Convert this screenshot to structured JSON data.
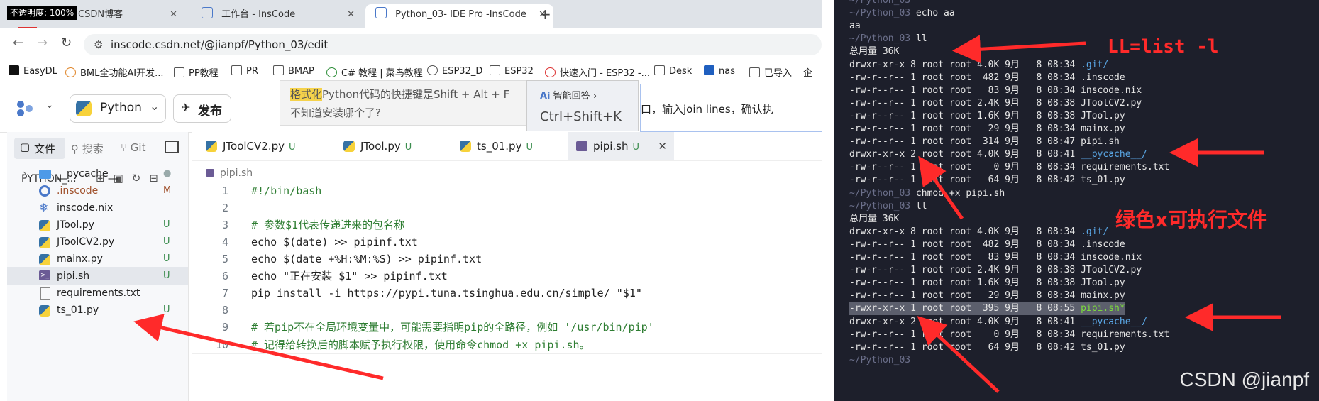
{
  "browser": {
    "opacity_badge": "不透明度: 100%",
    "tabs": [
      {
        "label": "CSDN博客",
        "close": "✕"
      },
      {
        "label": "工作台 - InsCode",
        "close": "✕"
      },
      {
        "label": "Python_03- IDE Pro -InsCode",
        "close": "✕"
      }
    ],
    "new_tab": "+",
    "url": "inscode.csdn.net/@jianpf/Python_03/edit",
    "bookmarks": [
      "EasyDL",
      "BML全功能AI开发...",
      "PP教程",
      "PR",
      "BMAP",
      "C# 教程 | 菜鸟教程",
      "ESP32_D",
      "ESP32",
      "快速入门 - ESP32 -...",
      "Desk",
      "nas",
      "已导入",
      "企"
    ]
  },
  "ide": {
    "lang": "Python",
    "publish": "发布",
    "tooltip": {
      "line1_hl": "格式化",
      "line1_rest": "Python代码的快捷键是Shift + Alt + F",
      "line2": "不知道安装哪个了?",
      "ai_label": "智能回答",
      "shortcut": "Ctrl+Shift+K",
      "hint": "口，输入join lines，确认执"
    },
    "sidebar": {
      "tabs": [
        "文件",
        "搜索",
        "Git"
      ],
      "project": "PYTHON_...",
      "files": [
        {
          "name": "__pycache__",
          "status": "●"
        },
        {
          "name": ".inscode",
          "status": "M"
        },
        {
          "name": "inscode.nix",
          "status": ""
        },
        {
          "name": "JTool.py",
          "status": "U"
        },
        {
          "name": "JToolCV2.py",
          "status": "U"
        },
        {
          "name": "mainx.py",
          "status": "U"
        },
        {
          "name": "pipi.sh",
          "status": "U"
        },
        {
          "name": "requirements.txt",
          "status": ""
        },
        {
          "name": "ts_01.py",
          "status": "U"
        }
      ]
    },
    "editor": {
      "tabs": [
        {
          "label": "JToolCV2.py",
          "status": "U"
        },
        {
          "label": "JTool.py",
          "status": "U"
        },
        {
          "label": "ts_01.py",
          "status": "U"
        },
        {
          "label": "pipi.sh",
          "status": "U"
        }
      ],
      "breadcrumb": "pipi.sh",
      "lines": [
        {
          "n": "1",
          "t": "#!/bin/bash"
        },
        {
          "n": "2",
          "t": ""
        },
        {
          "n": "3",
          "t": "# 参数$1代表传递进来的包名称"
        },
        {
          "n": "4",
          "t": "echo $(date) >> pipinf.txt"
        },
        {
          "n": "5",
          "t": "echo $(date +%H:%M:%S) >> pipinf.txt"
        },
        {
          "n": "6",
          "t": "echo \"正在安装 $1\" >> pipinf.txt"
        },
        {
          "n": "7",
          "t": "pip install -i https://pypi.tuna.tsinghua.edu.cn/simple/ \"$1\""
        },
        {
          "n": "8",
          "t": ""
        },
        {
          "n": "9",
          "t": "# 若pip不在全局环境变量中，可能需要指明pip的全路径，例如 '/usr/bin/pip'"
        },
        {
          "n": "10",
          "t": "# 记得给转换后的脚本赋予执行权限，使用命令chmod +x pipi.sh。"
        }
      ]
    }
  },
  "terminal": {
    "lines": [
      "~/Python_03",
      "~/Python_03 echo aa",
      "aa",
      "~/Python_03 ll",
      "总用量 36K",
      "drwxr-xr-x 8 root root 4.0K 9月   8 08:34 .git/",
      "-rw-r--r-- 1 root root  482 9月   8 08:34 .inscode",
      "-rw-r--r-- 1 root root   83 9月   8 08:34 inscode.nix",
      "-rw-r--r-- 1 root root 2.4K 9月   8 08:38 JToolCV2.py",
      "-rw-r--r-- 1 root root 1.6K 9月   8 08:38 JTool.py",
      "-rw-r--r-- 1 root root   29 9月   8 08:34 mainx.py",
      "-rw-r--r-- 1 root root  314 9月   8 08:47 pipi.sh",
      "drwxr-xr-x 2 root root 4.0K 9月   8 08:41 __pycache__/",
      "-rw-r--r-- 1 root root    0 9月   8 08:34 requirements.txt",
      "-rw-r--r-- 1 root root   64 9月   8 08:42 ts_01.py",
      "~/Python_03 chmod +x pipi.sh",
      "~/Python_03 ll",
      "总用量 36K",
      "drwxr-xr-x 8 root root 4.0K 9月   8 08:34 .git/",
      "-rw-r--r-- 1 root root  482 9月   8 08:34 .inscode",
      "-rw-r--r-- 1 root root   83 9月   8 08:34 inscode.nix",
      "-rw-r--r-- 1 root root 2.4K 9月   8 08:38 JToolCV2.py",
      "-rw-r--r-- 1 root root 1.6K 9月   8 08:38 JTool.py",
      "-rw-r--r-- 1 root root   29 9月   8 08:34 mainx.py",
      "-rwxr-xr-x 1 root root  395 9月   8 08:55 pipi.sh*",
      "drwxr-xr-x 2 root root 4.0K 9月   8 08:41 __pycache__/",
      "-rw-r--r-- 1 root root    0 9月   8 08:34 requirements.txt",
      "-rw-r--r-- 1 root root   64 9月   8 08:42 ts_01.py",
      "~/Python_03"
    ],
    "annotation1": "LL=list -l",
    "annotation2": "绿色x可执行文件",
    "watermark": "CSDN @jianpf"
  },
  "colors": {
    "annotation": "#ff2a2a",
    "terminal_bg": "#1d1f2b",
    "exec_green": "#7dde3c",
    "dir_blue": "#5aa7e6"
  }
}
